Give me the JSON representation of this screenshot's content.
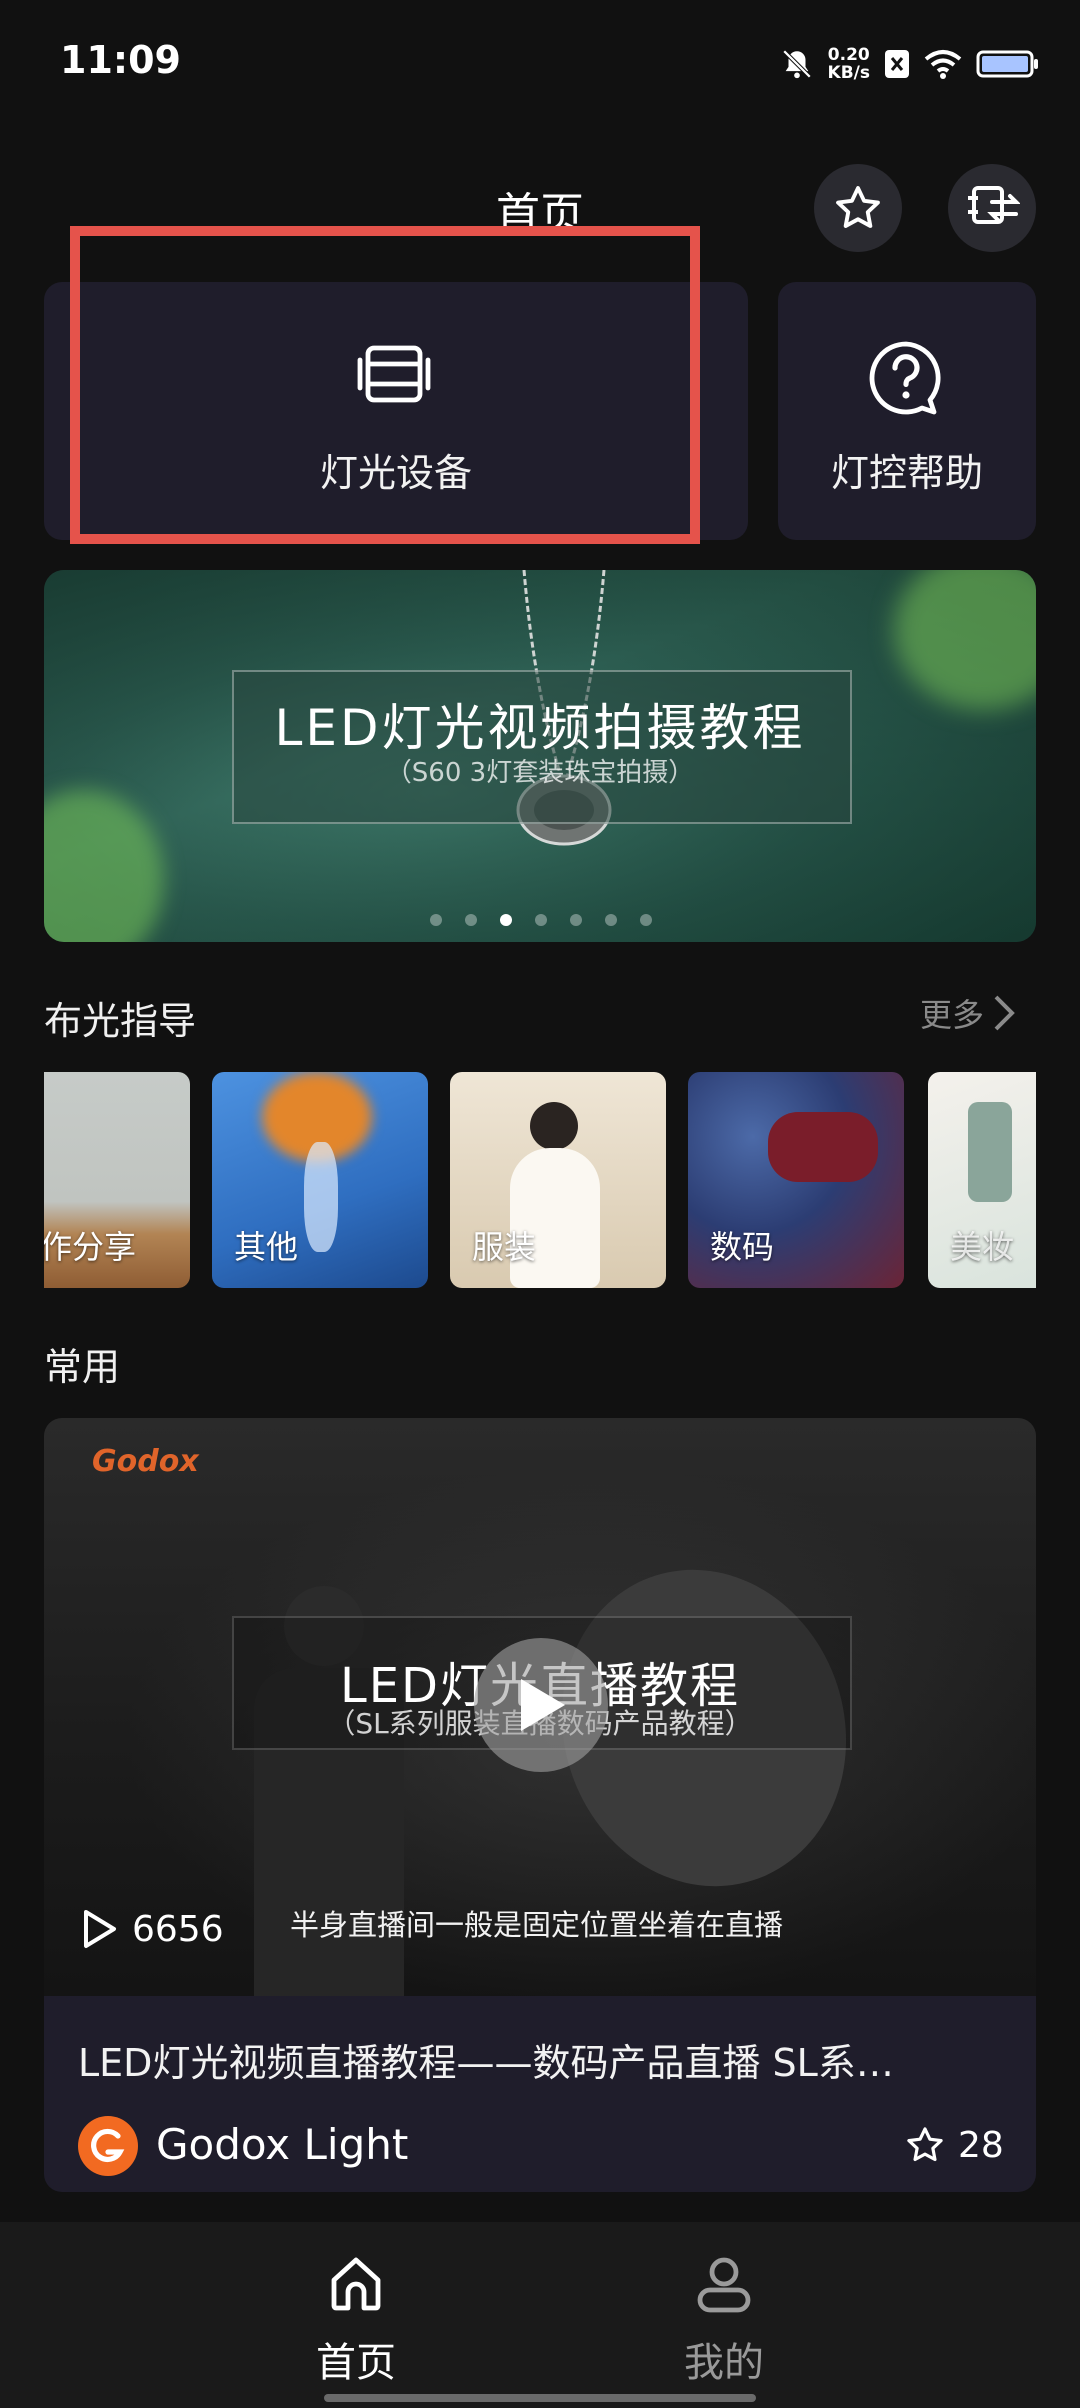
{
  "status_bar": {
    "time": "11:09",
    "speed_value": "0.20",
    "speed_unit": "KB/s",
    "icons": [
      "mute-bell-icon",
      "data-blocked-icon",
      "wifi-icon",
      "battery-icon"
    ]
  },
  "header": {
    "title": "首页",
    "favorite_icon": "star-outline-icon",
    "switch_icon": "device-switch-icon"
  },
  "quick_cards": [
    {
      "label": "灯光设备",
      "icon": "light-device-icon",
      "highlighted": true
    },
    {
      "label": "灯控帮助",
      "icon": "help-question-icon",
      "highlighted": false
    }
  ],
  "banner": {
    "title": "LED灯光视频拍摄教程",
    "subtitle": "（S60 3灯套装珠宝拍摄）",
    "dot_count": 7,
    "active_dot": 2
  },
  "lighting_guide": {
    "title": "布光指导",
    "more_label": "更多",
    "categories": [
      {
        "label": "作分享",
        "colors": [
          "#c6cbc8",
          "#b28454"
        ]
      },
      {
        "label": "其他",
        "colors": [
          "#3f7fd0",
          "#1f4f95"
        ]
      },
      {
        "label": "服装",
        "colors": [
          "#e8e0d2",
          "#b9a88b"
        ]
      },
      {
        "label": "数码",
        "colors": [
          "#3a4b86",
          "#8a2f3c"
        ]
      },
      {
        "label": "美妆",
        "colors": [
          "#f0ece6",
          "#c9d7cf"
        ]
      }
    ]
  },
  "common": {
    "title": "常用",
    "video": {
      "brand_watermark": "Godox",
      "overlay_title": "LED灯光直播教程",
      "overlay_subtitle": "（SL系列服装直播数码产品教程）",
      "caption": "半身直播间一般是固定位置坐着在直播",
      "play_count": "6656",
      "title": "LED灯光视频直播教程——数码产品直播 SL系…",
      "author": "Godox Light",
      "favorites": "28"
    }
  },
  "bottom_nav": [
    {
      "label": "首页",
      "icon": "home-icon",
      "active": true
    },
    {
      "label": "我的",
      "icon": "profile-icon",
      "active": false
    }
  ],
  "colors": {
    "background": "#111111",
    "card": "#1f1d2b",
    "highlight_border": "#e5534b",
    "brand_orange": "#f26a21"
  }
}
